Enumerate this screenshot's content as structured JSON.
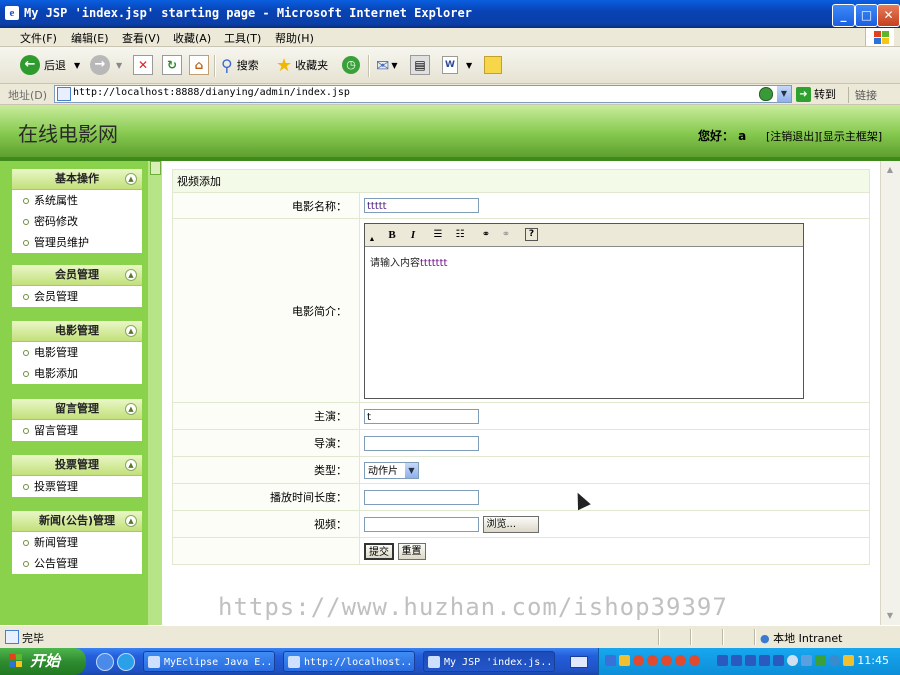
{
  "window": {
    "title": "My JSP 'index.jsp' starting page - Microsoft Internet Explorer",
    "controls": {
      "minimize": "_",
      "maximize": "□",
      "close": "✕"
    }
  },
  "menubar": [
    "文件(F)",
    "编辑(E)",
    "查看(V)",
    "收藏(A)",
    "工具(T)",
    "帮助(H)"
  ],
  "toolbar": {
    "back": "后退",
    "search": "搜索",
    "favorites": "收藏夹"
  },
  "address": {
    "label": "地址(D)",
    "url": "http://localhost:8888/dianying/admin/index.jsp",
    "go": "转到",
    "links": "链接"
  },
  "header": {
    "site_title": "在线电影网",
    "hello": "您好：  a",
    "logout": "[注销退出]",
    "show_main": "[显示主框架]"
  },
  "sidebar": [
    {
      "title": "基本操作",
      "items": [
        "系统属性",
        "密码修改",
        "管理员维护"
      ]
    },
    {
      "title": "会员管理",
      "items": [
        "会员管理"
      ]
    },
    {
      "title": "电影管理",
      "items": [
        "电影管理",
        "电影添加"
      ]
    },
    {
      "title": "留言管理",
      "items": [
        "留言管理"
      ]
    },
    {
      "title": "投票管理",
      "items": [
        "投票管理"
      ]
    },
    {
      "title": "新闻(公告)管理",
      "items": [
        "新闻管理",
        "公告管理"
      ]
    }
  ],
  "form": {
    "title": "视频添加",
    "name_label": "电影名称：",
    "name_value": "ttttt",
    "intro_label": "电影简介：",
    "intro_placeholder": "请输入内容",
    "intro_value": "ttttttt",
    "editor_buttons": {
      "bold": "B",
      "italic": "I",
      "help": "?"
    },
    "actor_label": "主演：",
    "actor_value": "t",
    "director_label": "导演：",
    "director_value": "",
    "type_label": "类型：",
    "type_value": "动作片",
    "duration_label": "播放时间长度：",
    "duration_value": "",
    "video_label": "视频：",
    "browse": "浏览...",
    "submit": "提交",
    "reset": "重置"
  },
  "watermark": "https://www.huzhan.com/ishop39397",
  "status": {
    "text": "完毕",
    "zone": "本地 Intranet"
  },
  "taskbar": {
    "start": "开始",
    "tasks": [
      "MyEclipse Java E...",
      "http://localhost...",
      "My JSP 'index.js..."
    ],
    "clock": "11:45"
  },
  "colors": {
    "header_green": "#86c94f",
    "sidebar_green": "#8ad14c",
    "xp_blue": "#245edb"
  }
}
